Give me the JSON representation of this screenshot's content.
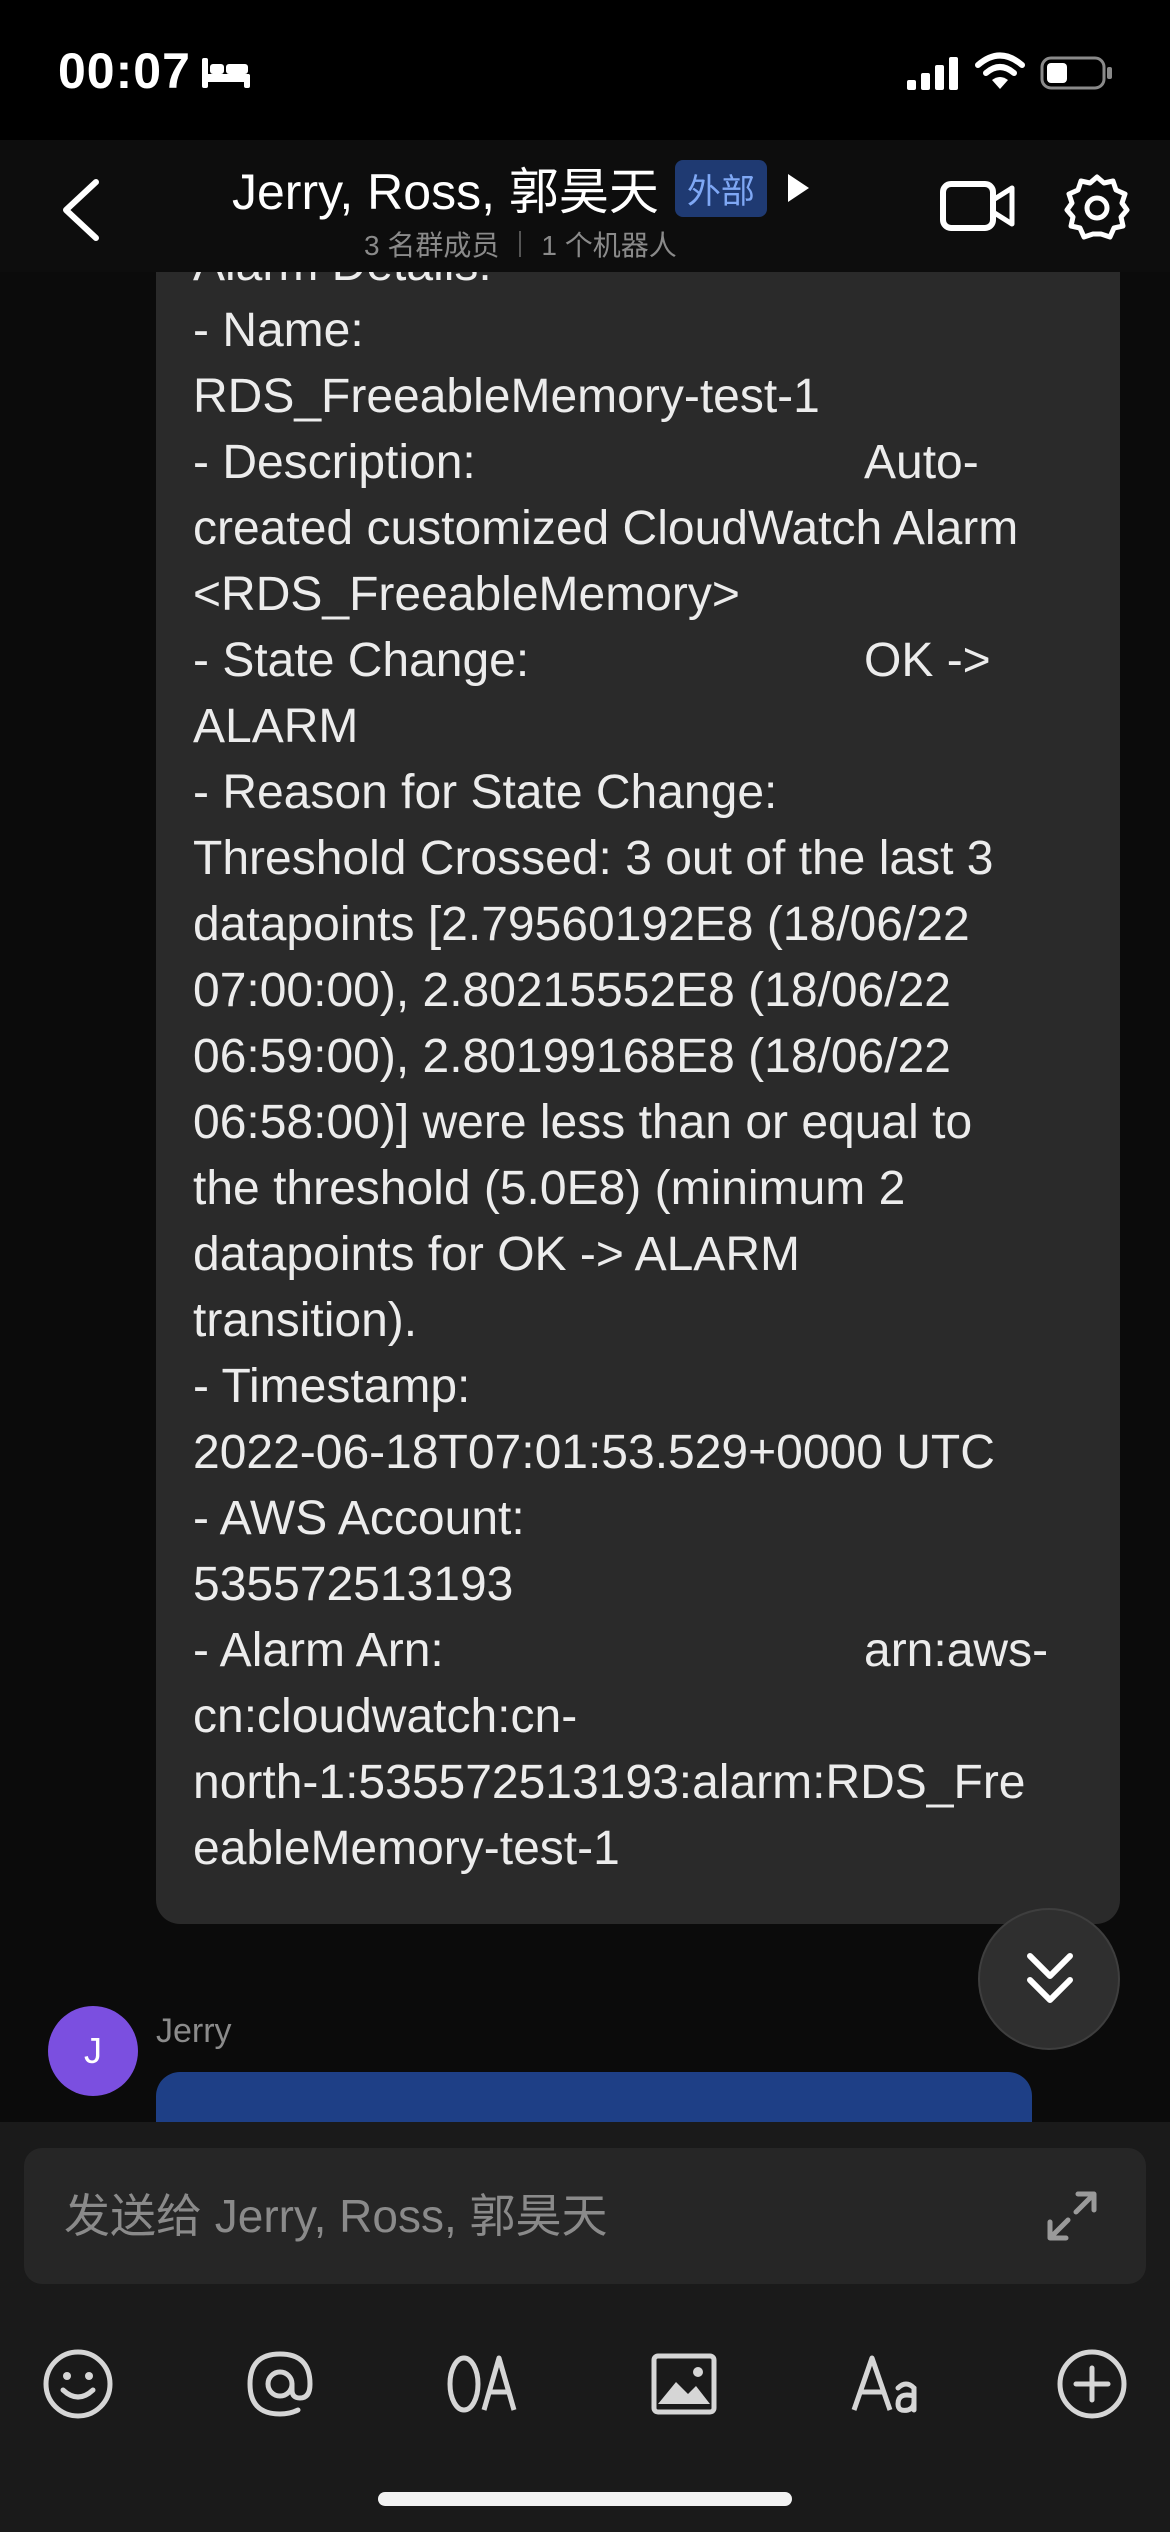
{
  "status_bar": {
    "time": "00:07",
    "icons": [
      "bed-icon",
      "signal-icon",
      "wifi-icon",
      "battery-icon"
    ]
  },
  "header": {
    "title": "Jerry, Ross, 郭昊天",
    "external_badge": "外部",
    "members": "3 名群成员",
    "bots": "1 个机器人",
    "icons": [
      "back-icon",
      "expand-arrow-icon",
      "video-call-icon",
      "settings-icon"
    ]
  },
  "message": {
    "lines": [
      "Alarm Details:",
      "- Name:",
      "RDS_FreeableMemory-test-1",
      "- Description:",
      "created customized CloudWatch Alarm",
      "<RDS_FreeableMemory>",
      "- State Change:",
      "ALARM",
      "- Reason for State Change:",
      "Threshold Crossed: 3 out of the last 3",
      "datapoints [2.79560192E8 (18/06/22",
      "07:00:00), 2.80215552E8 (18/06/22",
      "06:59:00), 2.80199168E8 (18/06/22",
      "06:58:00)] were less than or equal to",
      "the threshold (5.0E8) (minimum 2",
      "datapoints for OK -> ALARM",
      "transition).",
      "- Timestamp:",
      "2022-06-18T07:01:53.529+0000 UTC",
      "- AWS Account:",
      "535572513193",
      "- Alarm Arn:",
      "cn:cloudwatch:cn-",
      "north-1:535572513193:alarm:RDS_Fre",
      "eableMemory-test-1"
    ],
    "right_description": "Auto-",
    "right_state": "OK ->",
    "right_arn": "arn:aws-"
  },
  "next_message": {
    "avatar_letter": "J",
    "sender": "Jerry"
  },
  "compose": {
    "placeholder": "发送给 Jerry, Ross, 郭昊天",
    "toolbar_icons": [
      "emoji-icon",
      "mention-icon",
      "ocr-text-icon",
      "image-icon",
      "font-style-icon",
      "add-icon"
    ]
  },
  "colors": {
    "background": "#000000",
    "bubble": "#2a2a2a",
    "badge_bg": "#1f3a72",
    "badge_text": "#7fa8f5",
    "avatar": "#7b4fe0",
    "outgoing_bubble": "#1e3f86"
  }
}
